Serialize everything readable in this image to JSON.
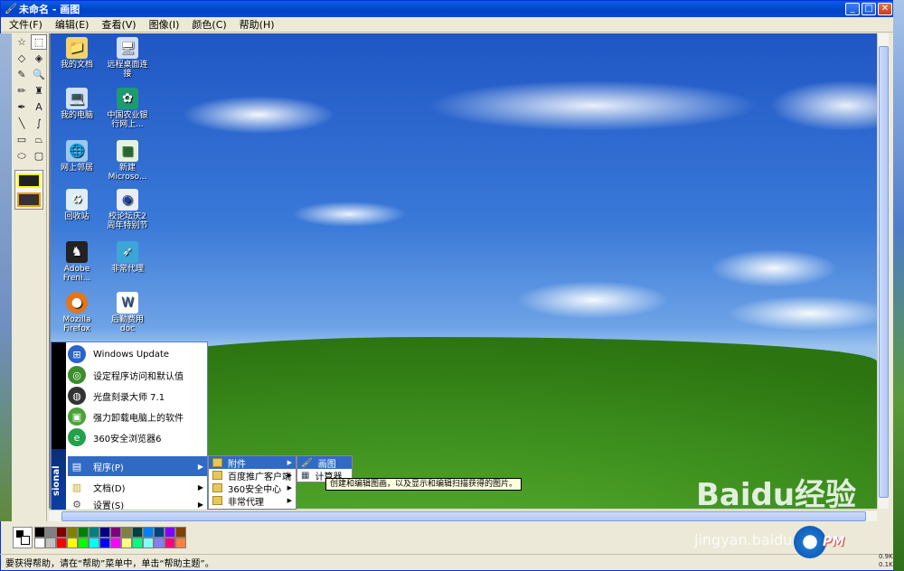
{
  "window": {
    "title": "未命名 - 画图"
  },
  "menubar": [
    {
      "label": "文件(F)"
    },
    {
      "label": "编辑(E)"
    },
    {
      "label": "查看(V)"
    },
    {
      "label": "图像(I)"
    },
    {
      "label": "颜色(C)"
    },
    {
      "label": "帮助(H)"
    }
  ],
  "desktop_icons": [
    {
      "label": "我的文档",
      "icon": "folder-icon"
    },
    {
      "label": "远程桌面连接",
      "icon": "remote-desktop-icon"
    },
    {
      "label": "我的电脑",
      "icon": "computer-icon"
    },
    {
      "label": "中国农业银行网上...",
      "icon": "bank-icon"
    },
    {
      "label": "网上邻居",
      "icon": "network-icon"
    },
    {
      "label": "新建 Microso...",
      "icon": "excel-icon"
    },
    {
      "label": "回收站",
      "icon": "recycle-bin-icon"
    },
    {
      "label": "校论坛庆2周年特别节",
      "icon": "media-icon"
    },
    {
      "label": "Adobe Freni...",
      "icon": "adobe-icon"
    },
    {
      "label": "非常代理",
      "icon": "proxy-icon"
    },
    {
      "label": "Mozilla Firefox",
      "icon": "firefox-icon"
    },
    {
      "label": "后勤费用 doc",
      "icon": "word-icon"
    }
  ],
  "start_menu": {
    "items": [
      {
        "label": "Windows Update",
        "color": "#2a64c5"
      },
      {
        "label": "设定程序访问和默认值",
        "color": "#3b8e2a"
      },
      {
        "label": "光盘刻录大师 7.1",
        "color": "#333333"
      },
      {
        "label": "强力卸载电脑上的软件",
        "color": "#4aa336"
      },
      {
        "label": "360安全浏览器6",
        "color": "#23a04a"
      }
    ],
    "programs_label": "程序(P)",
    "documents_label": "文档(D)",
    "settings_label": "设置(S)",
    "strip_text": "sional"
  },
  "submenu_programs": [
    {
      "label": "附件"
    },
    {
      "label": "百度推广客户端"
    },
    {
      "label": "360安全中心"
    },
    {
      "label": "非常代理"
    }
  ],
  "submenu_accessories": [
    {
      "label": "画图"
    },
    {
      "label": "计算器"
    }
  ],
  "tooltip": "创建和编辑图画，以及显示和编辑扫描获得的图片。",
  "statusbar": {
    "text": "要获得帮助，请在“帮助”菜单中，单击“帮助主题”。"
  },
  "palette": {
    "row1": [
      "#000000",
      "#808080",
      "#800000",
      "#808000",
      "#008000",
      "#008080",
      "#000080",
      "#800080",
      "#808040",
      "#004040",
      "#0080ff",
      "#004080",
      "#8000ff",
      "#804000"
    ],
    "row2": [
      "#ffffff",
      "#c0c0c0",
      "#ff0000",
      "#ffff00",
      "#00ff00",
      "#00ffff",
      "#0000ff",
      "#ff00ff",
      "#ffff80",
      "#00ff80",
      "#80ffff",
      "#8080ff",
      "#ff0080",
      "#ff8040"
    ]
  },
  "watermark": {
    "brand": "Baidu经验",
    "url": "jingyan.baidu.com",
    "pm": "PM"
  },
  "network": {
    "up": "0.9K",
    "down": "0.1K"
  }
}
